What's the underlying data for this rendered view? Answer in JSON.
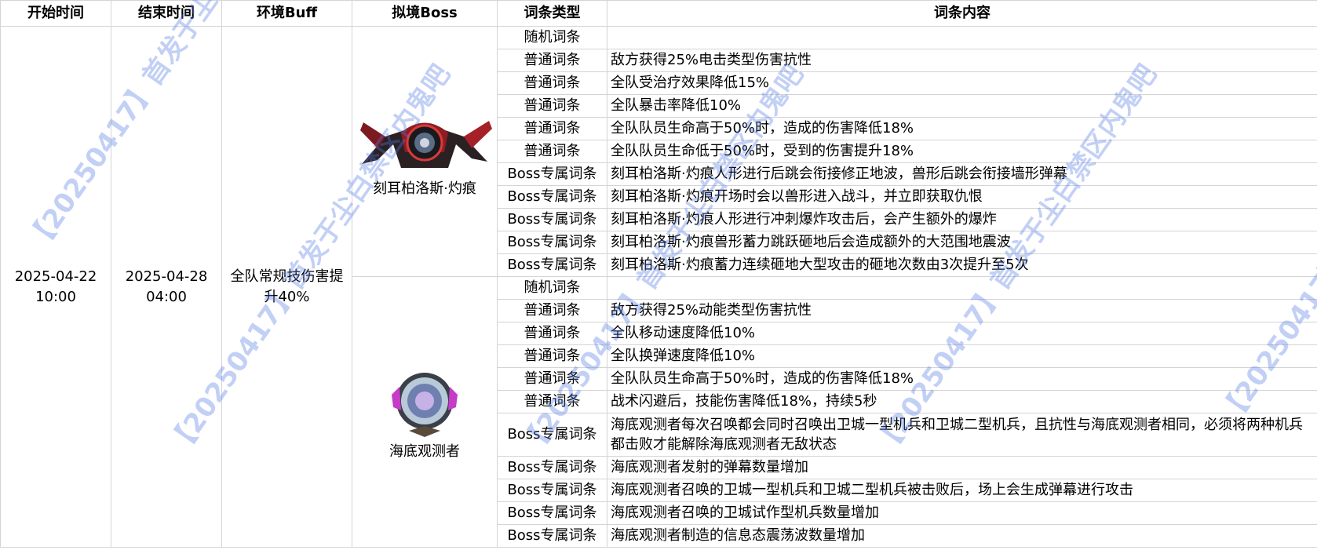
{
  "headers": [
    "开始时间",
    "结束时间",
    "环境Buff",
    "拟境Boss",
    "词条类型",
    "词条内容"
  ],
  "start_time": "2025-04-22 10:00",
  "end_time": "2025-04-28 04:00",
  "env_buff": "全队常规技伤害提升40%",
  "bosses": [
    {
      "name": "刻耳柏洛斯·灼痕",
      "icon": "robot-boss-icon",
      "rows": [
        {
          "type": "随机词条",
          "content": ""
        },
        {
          "type": "普通词条",
          "content": "敌方获得25%电击类型伤害抗性"
        },
        {
          "type": "普通词条",
          "content": "全队受治疗效果降低15%"
        },
        {
          "type": "普通词条",
          "content": "全队暴击率降低10%"
        },
        {
          "type": "普通词条",
          "content": "全队队员生命高于50%时，造成的伤害降低18%"
        },
        {
          "type": "普通词条",
          "content": "全队队员生命低于50%时，受到的伤害提升18%"
        },
        {
          "type": "Boss专属词条",
          "content": "刻耳柏洛斯·灼痕人形进行后跳会衔接修正地波，兽形后跳会衔接墙形弹幕"
        },
        {
          "type": "Boss专属词条",
          "content": "刻耳柏洛斯·灼痕开场时会以兽形进入战斗，并立即获取仇恨"
        },
        {
          "type": "Boss专属词条",
          "content": "刻耳柏洛斯·灼痕人形进行冲刺爆炸攻击后，会产生额外的爆炸"
        },
        {
          "type": "Boss专属词条",
          "content": "刻耳柏洛斯·灼痕兽形蓄力跳跃砸地后会造成额外的大范围地震波"
        },
        {
          "type": "Boss专属词条",
          "content": "刻耳柏洛斯·灼痕蓄力连续砸地大型攻击的砸地次数由3次提升至5次"
        }
      ]
    },
    {
      "name": "海底观测者",
      "icon": "sphere-boss-icon",
      "rows": [
        {
          "type": "随机词条",
          "content": ""
        },
        {
          "type": "普通词条",
          "content": "敌方获得25%动能类型伤害抗性"
        },
        {
          "type": "普通词条",
          "content": "全队移动速度降低10%"
        },
        {
          "type": "普通词条",
          "content": "全队换弹速度降低10%"
        },
        {
          "type": "普通词条",
          "content": "全队队员生命高于50%时，造成的伤害降低18%"
        },
        {
          "type": "普通词条",
          "content": "战术闪避后，技能伤害降低18%，持续5秒"
        },
        {
          "type": "Boss专属词条",
          "content": "海底观测者每次召唤都会同时召唤出卫城一型机兵和卫城二型机兵，且抗性与海底观测者相同，必须将两种机兵都击败才能解除海底观测者无敌状态",
          "tall": true
        },
        {
          "type": "Boss专属词条",
          "content": "海底观测者发射的弹幕数量增加"
        },
        {
          "type": "Boss专属词条",
          "content": "海底观测者召唤的卫城一型机兵和卫城二型机兵被击败后，场上会生成弹幕进行攻击"
        },
        {
          "type": "Boss专属词条",
          "content": "海底观测者召唤的卫城试作型机兵数量增加"
        },
        {
          "type": "Boss专属词条",
          "content": "海底观测者制造的信息态震荡波数量增加"
        }
      ]
    }
  ],
  "watermark": "【20250417】首发于尘白禁区内鬼吧",
  "colors": {
    "grid": "#d4d4d4",
    "watermark": "#5078e6"
  }
}
